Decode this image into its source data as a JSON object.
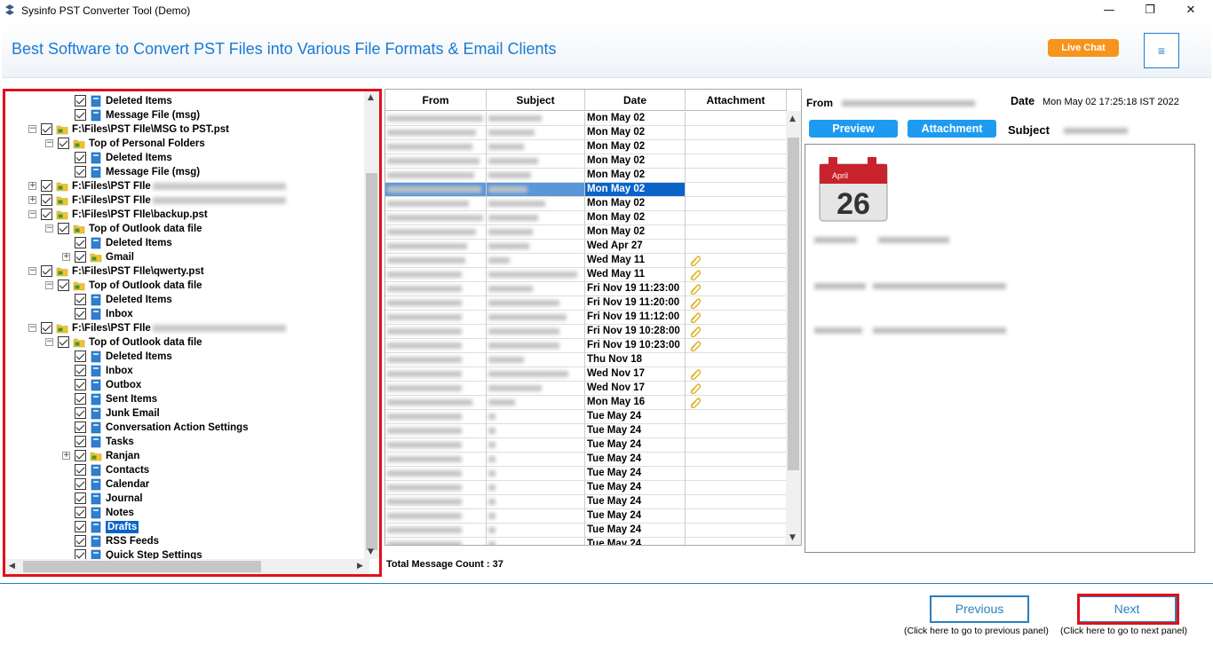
{
  "window": {
    "title": "Sysinfo PST Converter Tool (Demo)",
    "controls": [
      "—",
      "❐",
      "✕"
    ]
  },
  "banner": {
    "text": "Best Software to Convert PST Files into Various File Formats & Email Clients",
    "live_chat": "Live Chat",
    "menu_icon": "≡"
  },
  "tree": {
    "items": [
      {
        "label": "Deleted Items",
        "level": 2,
        "expander": "",
        "redacted": false,
        "selected": false
      },
      {
        "label": "Message File (msg)",
        "level": 2,
        "expander": "",
        "redacted": false,
        "selected": false
      },
      {
        "label": "F:\\Files\\PST FIle\\MSG to PST.pst",
        "level": 0,
        "expander": "−",
        "redacted": false,
        "selected": false
      },
      {
        "label": "Top of Personal Folders",
        "level": 1,
        "expander": "−",
        "redacted": false,
        "selected": false
      },
      {
        "label": "Deleted Items",
        "level": 2,
        "expander": "",
        "redacted": false,
        "selected": false
      },
      {
        "label": "Message File (msg)",
        "level": 2,
        "expander": "",
        "redacted": false,
        "selected": false
      },
      {
        "label": "F:\\Files\\PST FIle",
        "level": 0,
        "expander": "+",
        "redacted": true,
        "selected": false
      },
      {
        "label": "F:\\Files\\PST FIle",
        "level": 0,
        "expander": "+",
        "redacted": true,
        "selected": false
      },
      {
        "label": "F:\\Files\\PST FIle\\backup.pst",
        "level": 0,
        "expander": "−",
        "redacted": false,
        "selected": false
      },
      {
        "label": "Top of Outlook data file",
        "level": 1,
        "expander": "−",
        "redacted": false,
        "selected": false
      },
      {
        "label": "Deleted Items",
        "level": 2,
        "expander": "",
        "redacted": false,
        "selected": false
      },
      {
        "label": "Gmail",
        "level": 2,
        "expander": "+",
        "redacted": false,
        "selected": false
      },
      {
        "label": "F:\\Files\\PST FIle\\qwerty.pst",
        "level": 0,
        "expander": "−",
        "redacted": false,
        "selected": false
      },
      {
        "label": "Top of Outlook data file",
        "level": 1,
        "expander": "−",
        "redacted": false,
        "selected": false
      },
      {
        "label": "Deleted Items",
        "level": 2,
        "expander": "",
        "redacted": false,
        "selected": false
      },
      {
        "label": "Inbox",
        "level": 2,
        "expander": "",
        "redacted": false,
        "selected": false
      },
      {
        "label": "F:\\Files\\PST FIle",
        "level": 0,
        "expander": "−",
        "redacted": true,
        "selected": false
      },
      {
        "label": "Top of Outlook data file",
        "level": 1,
        "expander": "−",
        "redacted": false,
        "selected": false
      },
      {
        "label": "Deleted Items",
        "level": 2,
        "expander": "",
        "redacted": false,
        "selected": false
      },
      {
        "label": "Inbox",
        "level": 2,
        "expander": "",
        "redacted": false,
        "selected": false
      },
      {
        "label": "Outbox",
        "level": 2,
        "expander": "",
        "redacted": false,
        "selected": false
      },
      {
        "label": "Sent Items",
        "level": 2,
        "expander": "",
        "redacted": false,
        "selected": false
      },
      {
        "label": "Junk Email",
        "level": 2,
        "expander": "",
        "redacted": false,
        "selected": false
      },
      {
        "label": "Conversation Action Settings",
        "level": 2,
        "expander": "",
        "redacted": false,
        "selected": false
      },
      {
        "label": "Tasks",
        "level": 2,
        "expander": "",
        "redacted": false,
        "selected": false
      },
      {
        "label": "Ranjan",
        "level": 2,
        "expander": "+",
        "redacted": false,
        "selected": false
      },
      {
        "label": "Contacts",
        "level": 2,
        "expander": "",
        "redacted": false,
        "selected": false
      },
      {
        "label": "Calendar",
        "level": 2,
        "expander": "",
        "redacted": false,
        "selected": false
      },
      {
        "label": "Journal",
        "level": 2,
        "expander": "",
        "redacted": false,
        "selected": false
      },
      {
        "label": "Notes",
        "level": 2,
        "expander": "",
        "redacted": false,
        "selected": false
      },
      {
        "label": "Drafts",
        "level": 2,
        "expander": "",
        "redacted": false,
        "selected": true
      },
      {
        "label": "RSS Feeds",
        "level": 2,
        "expander": "",
        "redacted": false,
        "selected": false
      },
      {
        "label": "Quick Step Settings",
        "level": 2,
        "expander": "",
        "redacted": false,
        "selected": false
      }
    ]
  },
  "grid": {
    "columns": [
      "From",
      "Subject",
      "Date",
      "Attachment"
    ],
    "rows": [
      {
        "date": "Mon May 02",
        "attachment": false
      },
      {
        "date": "Mon May 02",
        "attachment": false
      },
      {
        "date": "Mon May 02",
        "attachment": false
      },
      {
        "date": "Mon May 02",
        "attachment": false
      },
      {
        "date": "Mon May 02",
        "attachment": false
      },
      {
        "date": "Mon May 02",
        "attachment": false,
        "selected": true
      },
      {
        "date": "Mon May 02",
        "attachment": false
      },
      {
        "date": "Mon May 02",
        "attachment": false
      },
      {
        "date": "Mon May 02",
        "attachment": false
      },
      {
        "date": "Wed Apr 27",
        "attachment": false
      },
      {
        "date": "Wed May 11",
        "attachment": true
      },
      {
        "date": "Wed May 11",
        "attachment": true
      },
      {
        "date": "Fri Nov 19 11:23:00",
        "attachment": true
      },
      {
        "date": "Fri Nov 19 11:20:00",
        "attachment": true
      },
      {
        "date": "Fri Nov 19 11:12:00",
        "attachment": true
      },
      {
        "date": "Fri Nov 19 10:28:00",
        "attachment": true
      },
      {
        "date": "Fri Nov 19 10:23:00",
        "attachment": true
      },
      {
        "date": "Thu Nov 18",
        "attachment": false
      },
      {
        "date": "Wed Nov 17",
        "attachment": true
      },
      {
        "date": "Wed Nov 17",
        "attachment": true
      },
      {
        "date": "Mon May 16",
        "attachment": true
      },
      {
        "date": "Tue May 24",
        "attachment": false
      },
      {
        "date": "Tue May 24",
        "attachment": false
      },
      {
        "date": "Tue May 24",
        "attachment": false
      },
      {
        "date": "Tue May 24",
        "attachment": false
      },
      {
        "date": "Tue May 24",
        "attachment": false
      },
      {
        "date": "Tue May 24",
        "attachment": false
      },
      {
        "date": "Tue May 24",
        "attachment": false
      },
      {
        "date": "Tue May 24",
        "attachment": false
      },
      {
        "date": "Tue May 24",
        "attachment": false
      },
      {
        "date": "Tue May 24",
        "attachment": false
      }
    ],
    "total_label": "Total Message Count : 37"
  },
  "preview": {
    "from_label": "From",
    "date_label": "Date",
    "date_value": "Mon May 02 17:25:18 IST 2022",
    "subject_label": "Subject",
    "tab_preview": "Preview",
    "tab_attachment": "Attachment",
    "calendar_month": "April",
    "calendar_day": "26"
  },
  "footer": {
    "previous_label": "Previous",
    "previous_hint": "(Click here to go to previous panel)",
    "next_label": "Next",
    "next_hint": "(Click here to go to next panel)"
  },
  "colors": {
    "accent": "#1a7ad3",
    "live_chat": "#f7941d",
    "highlight": "#e0101c",
    "tab": "#1e9bf0"
  }
}
